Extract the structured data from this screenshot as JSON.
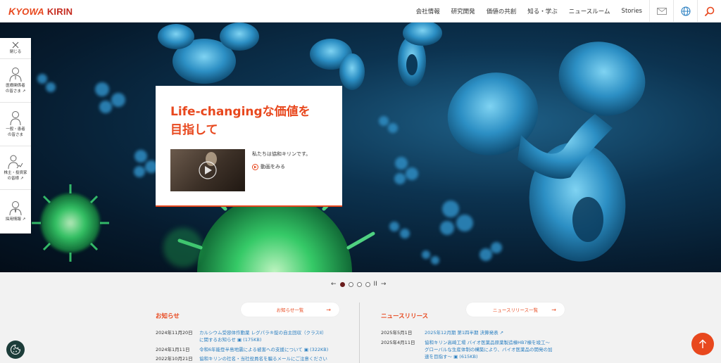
{
  "header": {
    "logo": {
      "k": "K",
      "yowa": "YOWA",
      "kirin": "KIRIN"
    },
    "nav": [
      "会社情報",
      "研究開発",
      "価値の共創",
      "知る・学ぶ",
      "ニュースルーム",
      "Stories"
    ],
    "icons": [
      "mail-icon",
      "globe-icon",
      "search-icon"
    ]
  },
  "side_tabs": {
    "close_label": "閉じる",
    "items": [
      {
        "line1": "医療関係者",
        "line2": "の皆さま"
      },
      {
        "line1": "一般・患者",
        "line2": "の皆さま"
      },
      {
        "line1": "株主・投資家",
        "line2": "の皆様"
      },
      {
        "line1": "採用情報",
        "line2": ""
      }
    ]
  },
  "hero_card": {
    "title_line1": "Life-changingな価値を",
    "title_line2": "目指して",
    "text": "私たちは協和キリンです。",
    "video_label": "動画をみる"
  },
  "carousel": {
    "prev": "←",
    "next": "→",
    "pause": "II",
    "count": 4,
    "active": 0
  },
  "notices": {
    "title": "お知らせ",
    "more_label": "お知らせ一覧",
    "items": [
      {
        "date": "2024年11月20日",
        "text": "カルシウム受容体作動薬 レグパラ®錠の自主回収（クラスⅡ）",
        "text2": "に関するお知らせ",
        "size": "(175KB)"
      },
      {
        "date": "2024年1月11日",
        "text": "令和6年能登半島地震による被害への支援について",
        "text2": "",
        "size": "(322KB)"
      },
      {
        "date": "2022年10月21日",
        "text": "協和キリンの社名・当社役員名を騙るメールにご注意ください",
        "text2": "",
        "size": ""
      }
    ]
  },
  "news": {
    "title": "ニュースリリース",
    "more_label": "ニュースリリース一覧",
    "items": [
      {
        "date": "2025年5月1日",
        "text": "2025年12月期 第1四半期 決算発表",
        "text2": "",
        "text3": "",
        "size": ""
      },
      {
        "date": "2025年4月11日",
        "text": "協和キリン高崎工場 バイオ医薬品原薬製造棟HB7棟を竣工～",
        "text2": "グローバルな生産体制の構築により、バイオ医薬品の開発の加",
        "text3": "速を目指す～",
        "size": "(615KB)"
      }
    ]
  },
  "colors": {
    "accent": "#e8481e",
    "link": "#2a7fc1",
    "cookie": "#1d3d3a"
  }
}
